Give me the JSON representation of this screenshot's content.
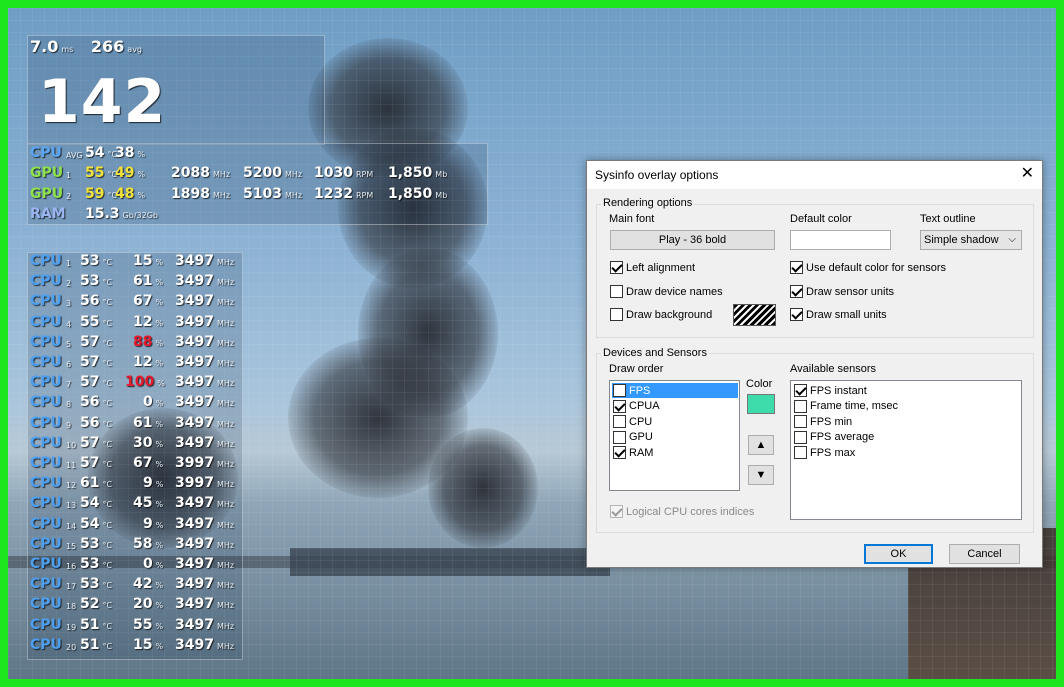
{
  "overlay": {
    "frametime": "7.0",
    "frametime_unit": "ms",
    "fps_avg": "266",
    "fps_avg_unit": "avg",
    "fps_big": "142",
    "summary": [
      {
        "label": "CPU",
        "sub": "AVG",
        "cols": [
          "54",
          "38",
          "",
          "",
          "",
          ""
        ],
        "units": [
          "°C",
          "%",
          "",
          "",
          "",
          ""
        ],
        "label_class": "lbl-blue"
      },
      {
        "label": "GPU",
        "sub": "1",
        "cols": [
          "55",
          "49",
          "2088",
          "5200",
          "1030",
          "1,850"
        ],
        "units": [
          "°C",
          "%",
          "MHz",
          "MHz",
          "RPM",
          "Mb"
        ],
        "label_class": "lbl-green"
      },
      {
        "label": "GPU",
        "sub": "2",
        "cols": [
          "59",
          "48",
          "1898",
          "5103",
          "1232",
          "1,850"
        ],
        "units": [
          "°C",
          "%",
          "MHz",
          "MHz",
          "RPM",
          "Mb"
        ],
        "label_class": "lbl-green"
      },
      {
        "label": "RAM",
        "sub": "",
        "cols": [
          "15.3"
        ],
        "units": [
          "Gb/32Gb"
        ],
        "label_class": "lbl-ram"
      }
    ],
    "cores": [
      {
        "label": "CPU",
        "idx": "1",
        "temp": "53",
        "load": "15",
        "clock": "3497",
        "hot": false
      },
      {
        "label": "CPU",
        "idx": "2",
        "temp": "53",
        "load": "61",
        "clock": "3497",
        "hot": false
      },
      {
        "label": "CPU",
        "idx": "3",
        "temp": "56",
        "load": "67",
        "clock": "3497",
        "hot": false
      },
      {
        "label": "CPU",
        "idx": "4",
        "temp": "55",
        "load": "12",
        "clock": "3497",
        "hot": false
      },
      {
        "label": "CPU",
        "idx": "5",
        "temp": "57",
        "load": "88",
        "clock": "3497",
        "hot": true
      },
      {
        "label": "CPU",
        "idx": "6",
        "temp": "57",
        "load": "12",
        "clock": "3497",
        "hot": false
      },
      {
        "label": "CPU",
        "idx": "7",
        "temp": "57",
        "load": "100",
        "clock": "3497",
        "hot": true
      },
      {
        "label": "CPU",
        "idx": "8",
        "temp": "56",
        "load": "0",
        "clock": "3497",
        "hot": false
      },
      {
        "label": "CPU",
        "idx": "9",
        "temp": "56",
        "load": "61",
        "clock": "3497",
        "hot": false
      },
      {
        "label": "CPU",
        "idx": "10",
        "temp": "57",
        "load": "30",
        "clock": "3497",
        "hot": false
      },
      {
        "label": "CPU",
        "idx": "11",
        "temp": "57",
        "load": "67",
        "clock": "3997",
        "hot": false
      },
      {
        "label": "CPU",
        "idx": "12",
        "temp": "61",
        "load": "9",
        "clock": "3997",
        "hot": false
      },
      {
        "label": "CPU",
        "idx": "13",
        "temp": "54",
        "load": "45",
        "clock": "3497",
        "hot": false
      },
      {
        "label": "CPU",
        "idx": "14",
        "temp": "54",
        "load": "9",
        "clock": "3497",
        "hot": false
      },
      {
        "label": "CPU",
        "idx": "15",
        "temp": "53",
        "load": "58",
        "clock": "3497",
        "hot": false
      },
      {
        "label": "CPU",
        "idx": "16",
        "temp": "53",
        "load": "0",
        "clock": "3497",
        "hot": false
      },
      {
        "label": "CPU",
        "idx": "17",
        "temp": "53",
        "load": "42",
        "clock": "3497",
        "hot": false
      },
      {
        "label": "CPU",
        "idx": "18",
        "temp": "52",
        "load": "20",
        "clock": "3497",
        "hot": false
      },
      {
        "label": "CPU",
        "idx": "19",
        "temp": "51",
        "load": "55",
        "clock": "3497",
        "hot": false
      },
      {
        "label": "CPU",
        "idx": "20",
        "temp": "51",
        "load": "15",
        "clock": "3497",
        "hot": false
      }
    ],
    "core_units": {
      "temp": "°C",
      "load": "%",
      "clock": "MHz"
    },
    "colors": {
      "hot": "#e8192c",
      "gpu_value": "#f2e23a",
      "cpu_label": "#4d9ff0"
    }
  },
  "dialog": {
    "title": "Sysinfo overlay options",
    "close_icon": "close-icon",
    "rendering": {
      "title": "Rendering options",
      "main_font_label": "Main font",
      "main_font_button": "Play - 36 bold",
      "default_color_label": "Default color",
      "text_outline_label": "Text outline",
      "text_outline_value": "Simple shadow",
      "left_alignment": {
        "label": "Left alignment",
        "checked": true
      },
      "draw_device_names": {
        "label": "Draw device names",
        "checked": false
      },
      "draw_background": {
        "label": "Draw background",
        "checked": false
      },
      "use_default_color": {
        "label": "Use default color for sensors",
        "checked": true
      },
      "draw_sensor_units": {
        "label": "Draw sensor units",
        "checked": true
      },
      "draw_small_units": {
        "label": "Draw small units",
        "checked": true
      }
    },
    "devices": {
      "title": "Devices and Sensors",
      "draw_order_label": "Draw order",
      "color_label": "Color",
      "swatch_color": "#3ddcaa",
      "draw_order": [
        {
          "label": "FPS",
          "checked": false,
          "selected": true
        },
        {
          "label": "CPUA",
          "checked": true,
          "selected": false
        },
        {
          "label": "CPU",
          "checked": false,
          "selected": false
        },
        {
          "label": "GPU",
          "checked": false,
          "selected": false
        },
        {
          "label": "RAM",
          "checked": true,
          "selected": false
        }
      ],
      "up_label": "▲",
      "down_label": "▼",
      "available_label": "Available sensors",
      "available": [
        {
          "label": "FPS instant",
          "checked": true
        },
        {
          "label": "Frame time, msec",
          "checked": false
        },
        {
          "label": "FPS min",
          "checked": false
        },
        {
          "label": "FPS average",
          "checked": false
        },
        {
          "label": "FPS max",
          "checked": false
        }
      ],
      "logical_cores": {
        "label": "Logical CPU cores indices",
        "checked": true
      }
    },
    "ok_label": "OK",
    "cancel_label": "Cancel"
  }
}
